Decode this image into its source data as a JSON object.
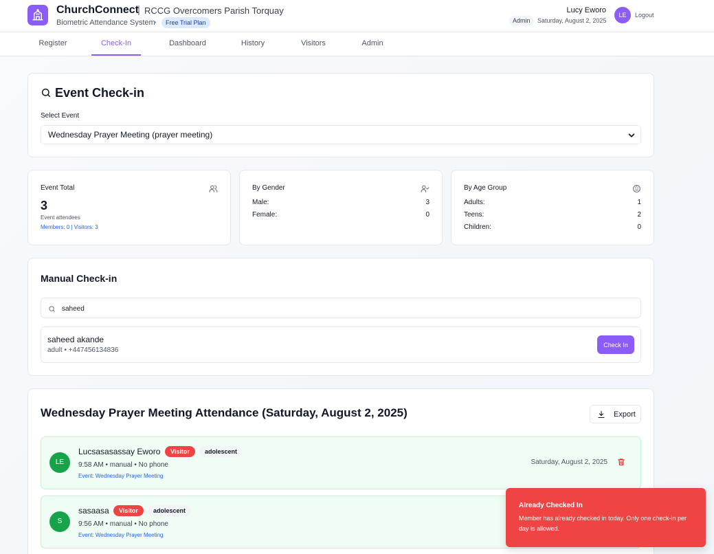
{
  "header": {
    "brand": "ChurchConnect",
    "separator": "|",
    "church_name": "RCCG Overcomers Parish Torquay",
    "subtitle": "Biometric Attendance System",
    "dot": "•",
    "plan": "Free Trial Plan",
    "user_name": "Lucy Eworo",
    "role": "Admin",
    "date": "Saturday, August 2, 2025",
    "avatar_initials": "LE",
    "logout": "Logout",
    "accent_color": "#8b5cf6"
  },
  "nav": {
    "tabs": [
      {
        "label": "Register"
      },
      {
        "label": "Check-In"
      },
      {
        "label": "Dashboard"
      },
      {
        "label": "History"
      },
      {
        "label": "Visitors"
      },
      {
        "label": "Admin"
      }
    ],
    "active": "Check-In"
  },
  "event_checkin": {
    "title": "Event Check-in",
    "select_label": "Select Event",
    "selected_event": "Wednesday Prayer Meeting (prayer meeting)"
  },
  "stats": {
    "total": {
      "label": "Event Total",
      "value": "3",
      "caption": "Event attendees",
      "breakdown": "Members: 0 | Visitors: 3"
    },
    "gender": {
      "label": "By Gender",
      "rows": [
        {
          "label": "Male:",
          "value": "3"
        },
        {
          "label": "Female:",
          "value": "0"
        }
      ]
    },
    "age": {
      "label": "By Age Group",
      "rows": [
        {
          "label": "Adults:",
          "value": "1"
        },
        {
          "label": "Teens:",
          "value": "2"
        },
        {
          "label": "Children:",
          "value": "0"
        }
      ]
    }
  },
  "manual": {
    "title": "Manual Check-in",
    "search_value": "saheed",
    "result": {
      "name": "saheed akande",
      "meta": "adult • +447456134836",
      "button": "Check In"
    }
  },
  "attendance": {
    "title": "Wednesday Prayer Meeting Attendance (Saturday, August 2, 2025)",
    "export_label": "Export",
    "rows": [
      {
        "initials": "LE",
        "name": "Lucsasasassay Eworo",
        "badge": "Visitor",
        "age": "adolescent",
        "meta": "9:58 AM • manual • No phone",
        "event": "Event: Wednesday Prayer Meeting",
        "date": "Saturday, August 2, 2025"
      },
      {
        "initials": "S",
        "name": "sasaasa",
        "badge": "Visitor",
        "age": "adolescent",
        "meta": "9:56 AM • manual • No phone",
        "event": "Event: Wednesday Prayer Meeting"
      }
    ]
  },
  "toast": {
    "title": "Already Checked In",
    "message": "Member has already checked in today. Only one check-in per day is allowed.",
    "color": "#ef4444"
  }
}
